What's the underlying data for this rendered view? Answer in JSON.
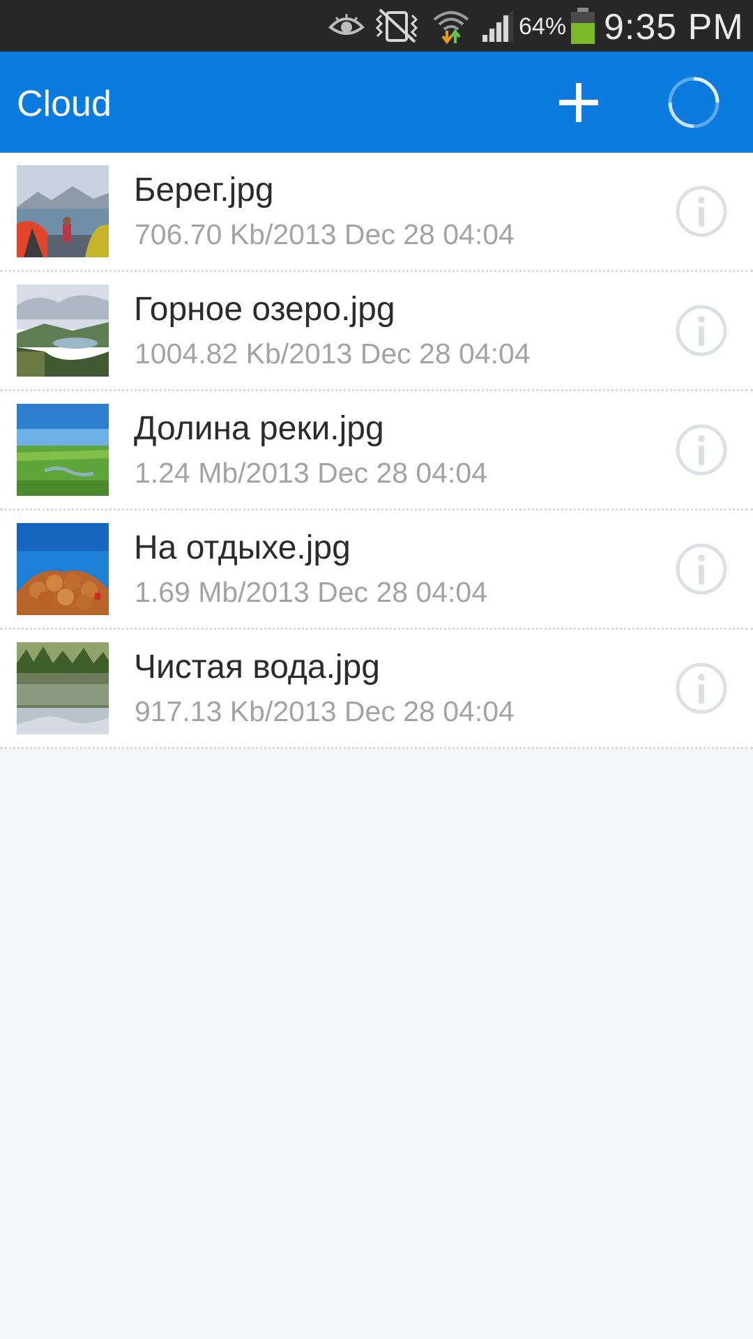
{
  "status_bar": {
    "battery_percent": "64%",
    "time": "9:35 PM",
    "icons": [
      "eye-icon",
      "vibrate-icon",
      "wifi-icon",
      "signal-icon",
      "battery-icon"
    ]
  },
  "app_bar": {
    "title": "Cloud",
    "add_icon": "plus-icon",
    "sync_icon": "loading-spinner-icon"
  },
  "colors": {
    "accent": "#0c7be0",
    "status_bar": "#272727",
    "background": "#f5f7fb",
    "battery": "#7cba2b"
  },
  "files": [
    {
      "name": "Берег.jpg",
      "meta": "706.70 Kb/2013 Dec 28 04:04"
    },
    {
      "name": "Горное озеро.jpg",
      "meta": "1004.82 Kb/2013 Dec 28 04:04"
    },
    {
      "name": "Долина реки.jpg",
      "meta": "1.24 Mb/2013 Dec 28 04:04"
    },
    {
      "name": "На отдыхе.jpg",
      "meta": "1.69 Mb/2013 Dec 28 04:04"
    },
    {
      "name": "Чистая вода.jpg",
      "meta": "917.13 Kb/2013 Dec 28 04:04"
    }
  ]
}
